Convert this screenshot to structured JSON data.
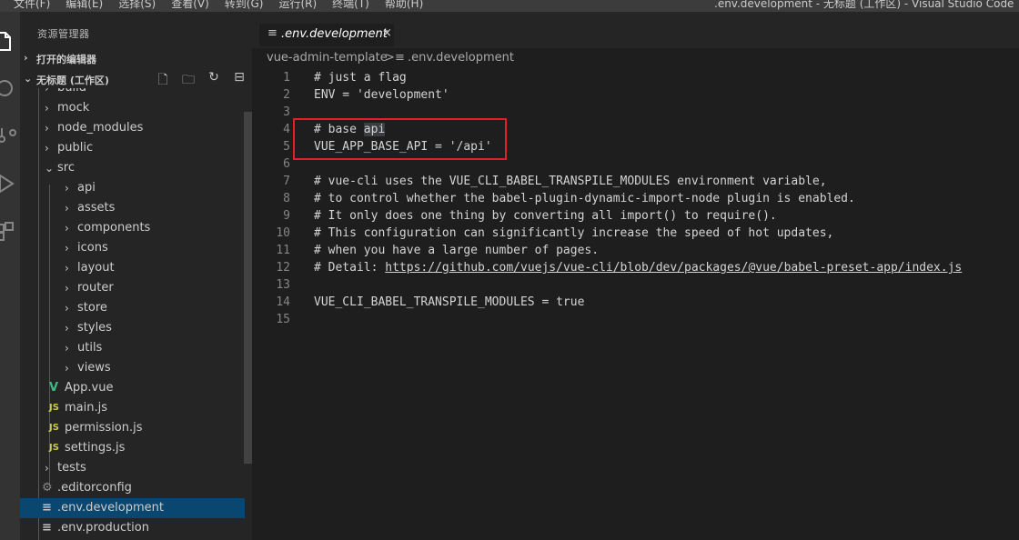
{
  "menubar": {
    "items": [
      "文件(F)",
      "编辑(E)",
      "选择(S)",
      "查看(V)",
      "转到(G)",
      "运行(R)",
      "终端(T)",
      "帮助(H)"
    ],
    "window_title": ".env.development - 无标题 (工作区) - Visual Studio Code"
  },
  "sidebar": {
    "title": "资源管理器",
    "open_editors": "打开的编辑器",
    "workspace": "无标题 (工作区)",
    "tools": {
      "new_file": "new-file-icon",
      "new_folder": "new-folder-icon",
      "refresh": "refresh-icon",
      "collapse": "collapse-all-icon"
    },
    "tree": [
      {
        "name": "build",
        "type": "folder",
        "depth": 1
      },
      {
        "name": "mock",
        "type": "folder",
        "depth": 1
      },
      {
        "name": "node_modules",
        "type": "folder",
        "depth": 1
      },
      {
        "name": "public",
        "type": "folder",
        "depth": 1
      },
      {
        "name": "src",
        "type": "folder-open",
        "depth": 1
      },
      {
        "name": "api",
        "type": "folder",
        "depth": 2
      },
      {
        "name": "assets",
        "type": "folder",
        "depth": 2
      },
      {
        "name": "components",
        "type": "folder",
        "depth": 2
      },
      {
        "name": "icons",
        "type": "folder",
        "depth": 2
      },
      {
        "name": "layout",
        "type": "folder",
        "depth": 2
      },
      {
        "name": "router",
        "type": "folder",
        "depth": 2
      },
      {
        "name": "store",
        "type": "folder",
        "depth": 2
      },
      {
        "name": "styles",
        "type": "folder",
        "depth": 2
      },
      {
        "name": "utils",
        "type": "folder",
        "depth": 2
      },
      {
        "name": "views",
        "type": "folder",
        "depth": 2
      },
      {
        "name": "App.vue",
        "type": "vue",
        "depth": 2
      },
      {
        "name": "main.js",
        "type": "js",
        "depth": 2
      },
      {
        "name": "permission.js",
        "type": "js",
        "depth": 2
      },
      {
        "name": "settings.js",
        "type": "js",
        "depth": 2
      },
      {
        "name": "tests",
        "type": "folder",
        "depth": 1
      },
      {
        "name": ".editorconfig",
        "type": "config",
        "depth": 1
      },
      {
        "name": ".env.development",
        "type": "text",
        "depth": 1,
        "selected": true
      },
      {
        "name": ".env.production",
        "type": "text",
        "depth": 1
      }
    ]
  },
  "tab": {
    "label": ".env.development",
    "close": "×"
  },
  "breadcrumb": {
    "folder": "vue-admin-template",
    "sep": ">",
    "file": ".env.development"
  },
  "editor": {
    "lines": [
      {
        "n": "1",
        "text": "# just a flag"
      },
      {
        "n": "2",
        "text": "ENV = 'development'"
      },
      {
        "n": "3",
        "text": ""
      },
      {
        "n": "4",
        "text": "# base api"
      },
      {
        "n": "5",
        "text": "VUE_APP_BASE_API = '/api'"
      },
      {
        "n": "6",
        "text": ""
      },
      {
        "n": "7",
        "text": "# vue-cli uses the VUE_CLI_BABEL_TRANSPILE_MODULES environment variable,"
      },
      {
        "n": "8",
        "text": "# to control whether the babel-plugin-dynamic-import-node plugin is enabled."
      },
      {
        "n": "9",
        "text": "# It only does one thing by converting all import() to require()."
      },
      {
        "n": "10",
        "text": "# This configuration can significantly increase the speed of hot updates,"
      },
      {
        "n": "11",
        "text": "# when you have a large number of pages."
      },
      {
        "n": "12",
        "text": "# Detail:  ",
        "link": "https://github.com/vuejs/vue-cli/blob/dev/packages/@vue/babel-preset-app/index.js"
      },
      {
        "n": "13",
        "text": ""
      },
      {
        "n": "14",
        "text": "VUE_CLI_BABEL_TRANSPILE_MODULES = true"
      },
      {
        "n": "15",
        "text": ""
      }
    ]
  },
  "colors": {
    "accent_selection": "#094771",
    "highlight_box": "#e0202b",
    "vue_green": "#41b883",
    "js_yellow": "#cbcb41"
  }
}
